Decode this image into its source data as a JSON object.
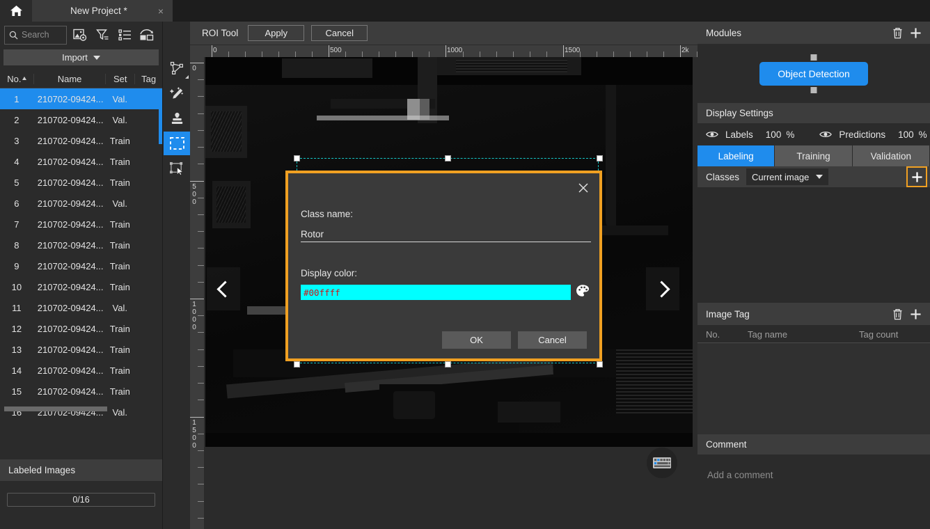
{
  "titlebar": {
    "home_icon": "home-icon",
    "tab_label": "New Project *",
    "tab_close": "×"
  },
  "left_panel": {
    "search": {
      "placeholder": "Search",
      "icon": "search-icon",
      "value": ""
    },
    "toolbar_icons": [
      "image-settings-icon",
      "filter-icon",
      "list-icon",
      "view-mode-icon"
    ],
    "import_button": "Import",
    "columns": [
      "No.",
      "Name",
      "Set",
      "Tag"
    ],
    "rows": [
      {
        "no": "1",
        "name": "210702-09424...",
        "set": "Val.",
        "tag": ""
      },
      {
        "no": "2",
        "name": "210702-09424...",
        "set": "Val.",
        "tag": ""
      },
      {
        "no": "3",
        "name": "210702-09424...",
        "set": "Train",
        "tag": ""
      },
      {
        "no": "4",
        "name": "210702-09424...",
        "set": "Train",
        "tag": ""
      },
      {
        "no": "5",
        "name": "210702-09424...",
        "set": "Train",
        "tag": ""
      },
      {
        "no": "6",
        "name": "210702-09424...",
        "set": "Val.",
        "tag": ""
      },
      {
        "no": "7",
        "name": "210702-09424...",
        "set": "Train",
        "tag": ""
      },
      {
        "no": "8",
        "name": "210702-09424...",
        "set": "Train",
        "tag": ""
      },
      {
        "no": "9",
        "name": "210702-09424...",
        "set": "Train",
        "tag": ""
      },
      {
        "no": "10",
        "name": "210702-09424...",
        "set": "Train",
        "tag": ""
      },
      {
        "no": "11",
        "name": "210702-09424...",
        "set": "Val.",
        "tag": ""
      },
      {
        "no": "12",
        "name": "210702-09424...",
        "set": "Train",
        "tag": ""
      },
      {
        "no": "13",
        "name": "210702-09424...",
        "set": "Train",
        "tag": ""
      },
      {
        "no": "14",
        "name": "210702-09424...",
        "set": "Train",
        "tag": ""
      },
      {
        "no": "15",
        "name": "210702-09424...",
        "set": "Train",
        "tag": ""
      },
      {
        "no": "16",
        "name": "210702-09424...",
        "set": "Val.",
        "tag": ""
      }
    ],
    "selected_row_index": 0,
    "labeled_images_title": "Labeled Images",
    "labeled_progress": "0/16"
  },
  "tool_strip": {
    "tools": [
      {
        "name": "polygon-tool-icon",
        "active": false
      },
      {
        "name": "magic-pencil-tool-icon",
        "active": false
      },
      {
        "name": "stamp-tool-icon",
        "active": false
      },
      {
        "name": "rectangle-select-tool-icon",
        "active": true
      },
      {
        "name": "transform-tool-icon",
        "active": false
      }
    ]
  },
  "center": {
    "roi_tool_label": "ROI Tool",
    "apply_button": "Apply",
    "cancel_button": "Cancel",
    "ruler_h_labels": [
      "0",
      "500",
      "1000",
      "1500",
      "2k"
    ],
    "ruler_v_labels": [
      "0",
      "500",
      "1000",
      "1500"
    ],
    "prev_button_icon": "chevron-left-icon",
    "next_button_icon": "chevron-right-icon",
    "keyboard_help_icon": "keyboard-icon",
    "selection_color": "#14c8c8"
  },
  "dialog": {
    "close_icon": "close-icon",
    "class_name_label": "Class name:",
    "class_name_value": "Rotor",
    "display_color_label": "Display color:",
    "display_color_value": "#00ffff",
    "palette_icon": "color-palette-icon",
    "ok_button": "OK",
    "cancel_button": "Cancel",
    "border_color": "#f0a022",
    "swatch_color": "#00ffff",
    "value_text_color": "#d01414"
  },
  "right_panel": {
    "modules": {
      "title": "Modules",
      "delete_icon": "trash-icon",
      "add_icon": "plus-icon",
      "node_label": "Object Detection",
      "node_color": "#1f8ced"
    },
    "display_settings": {
      "title": "Display Settings",
      "labels_eye_icon": "eye-icon",
      "labels_text": "Labels",
      "labels_value": "100",
      "labels_unit": "%",
      "predictions_eye_icon": "eye-icon",
      "predictions_text": "Predictions",
      "predictions_value": "100",
      "predictions_unit": "%"
    },
    "tabs": [
      {
        "label": "Labeling",
        "active": true
      },
      {
        "label": "Training",
        "active": false
      },
      {
        "label": "Validation",
        "active": false
      }
    ],
    "classes": {
      "label": "Classes",
      "scope_dropdown": "Current image",
      "add_icon": "plus-icon",
      "add_highlight_color": "#f0a022"
    },
    "image_tag": {
      "title": "Image Tag",
      "delete_icon": "trash-icon",
      "add_icon": "plus-icon",
      "columns": [
        "No.",
        "Tag name",
        "Tag count"
      ],
      "rows": []
    },
    "comment": {
      "title": "Comment",
      "placeholder": "Add a comment"
    }
  }
}
